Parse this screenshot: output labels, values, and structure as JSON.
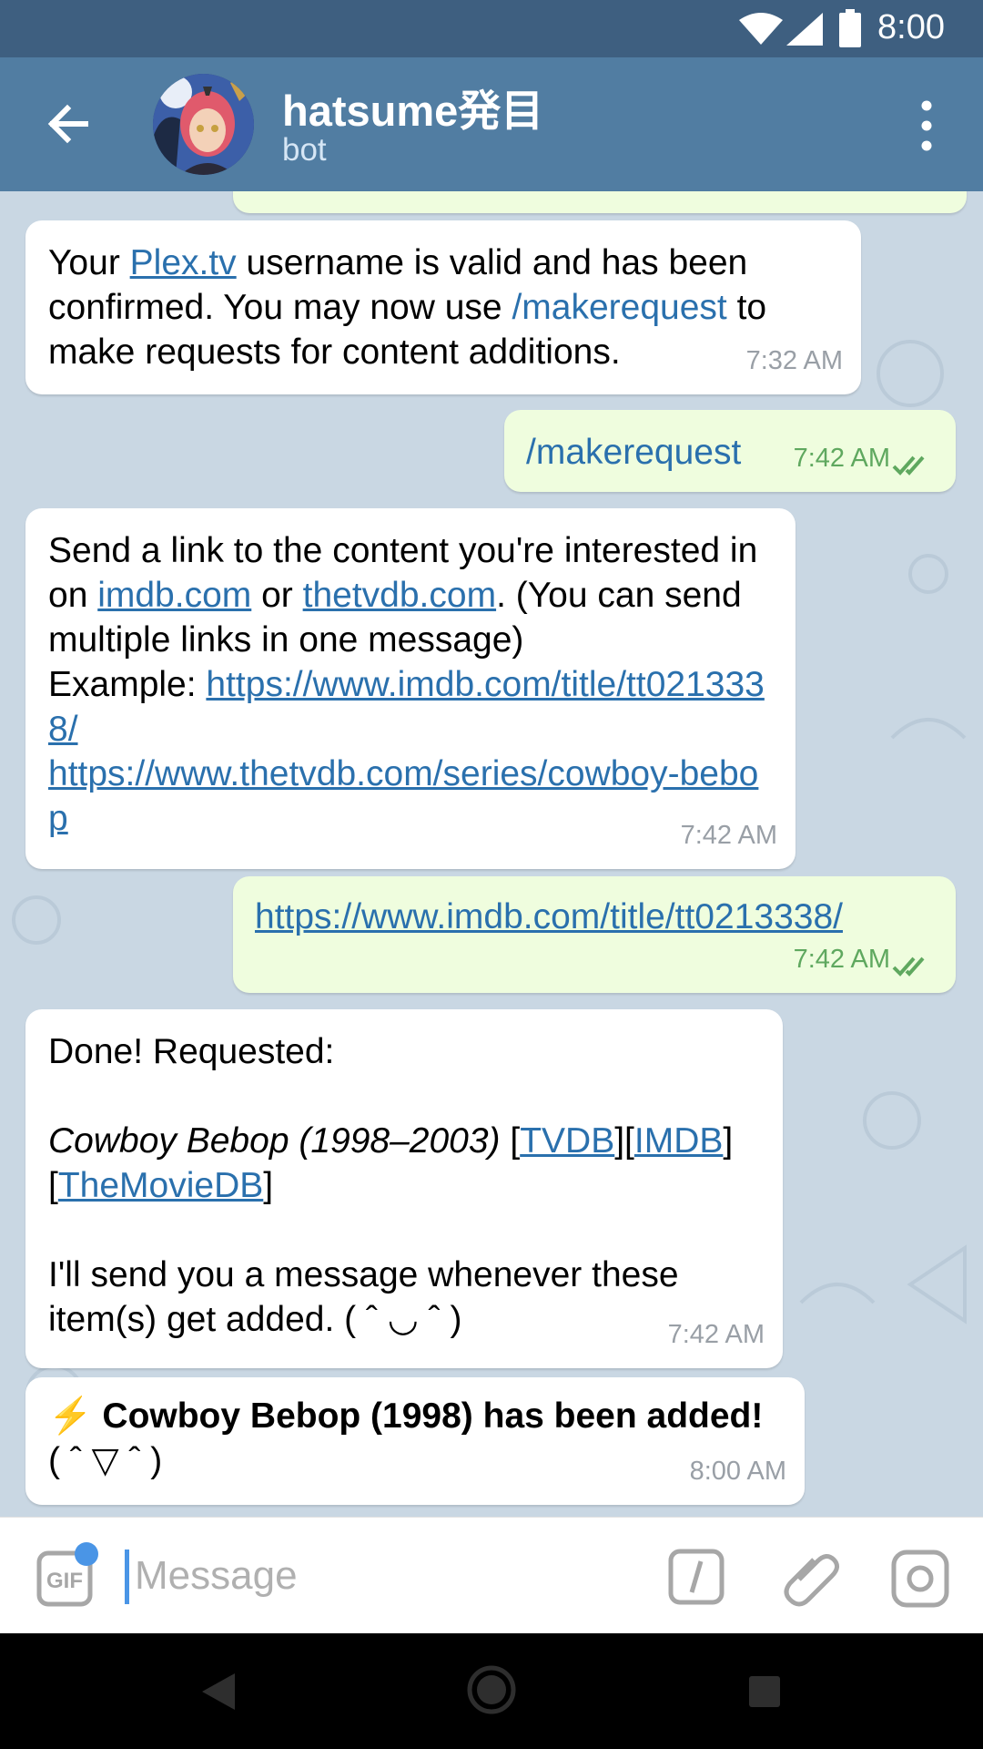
{
  "status_bar": {
    "time": "8:00"
  },
  "header": {
    "title": "hatsume発目",
    "subtitle": "bot"
  },
  "messages": {
    "m1": {
      "p1": "Your ",
      "link1": "Plex.tv",
      "p2": " username is valid and has been confirmed. You may now use ",
      "cmd": "/makerequest",
      "p3": " to make requests for content additions.",
      "time": "7:32 AM"
    },
    "m2": {
      "text": "/makerequest",
      "time": "7:42 AM"
    },
    "m3": {
      "p1": "Send a link to the content you're interested in on ",
      "link1": "imdb.com",
      "p2": " or ",
      "link2": "thetvdb.com",
      "p3": ". (You can send multiple links in one message)",
      "p4": "Example: ",
      "link3": "https://www.imdb.com/title/tt0213338/",
      "link4": "https://www.thetvdb.com/series/cowboy-bebop",
      "time": "7:42 AM"
    },
    "m4": {
      "link": "https://www.imdb.com/title/tt0213338/",
      "time": "7:42 AM"
    },
    "m5": {
      "line1": "Done! Requested:",
      "title": "Cowboy Bebop (1998–2003)",
      "b1": " [",
      "tvdb": "TVDB",
      "b2": "][",
      "imdb": "IMDB",
      "b3": "]",
      "b4": "[",
      "tmdb": "TheMovieDB",
      "b5": "]",
      "line3": "I'll send you a message whenever these item(s) get added. ( ˆ ◡ ˆ )",
      "time": "7:42 AM"
    },
    "m6": {
      "emoji": "⚡",
      "bold": "Cowboy Bebop (1998) has been added!",
      "face": "( ˆ ▽ ˆ )",
      "time": "8:00 AM"
    }
  },
  "input_bar": {
    "placeholder": "Message",
    "gif_label": "GIF"
  },
  "colors": {
    "header": "#517da2",
    "status_bar": "#3e5f80",
    "link": "#2a70ad",
    "outgoing_bubble": "#effdde",
    "incoming_bubble": "#ffffff",
    "read_ticks": "#5fa85f",
    "accent": "#4a95e6"
  },
  "icons": [
    "back-arrow-icon",
    "more-vert-icon",
    "wifi-icon",
    "signal-icon",
    "battery-icon",
    "gif-icon",
    "slash-command-icon",
    "paperclip-icon",
    "camera-icon",
    "double-check-icon",
    "nav-back-icon",
    "nav-home-icon",
    "nav-recents-icon"
  ]
}
